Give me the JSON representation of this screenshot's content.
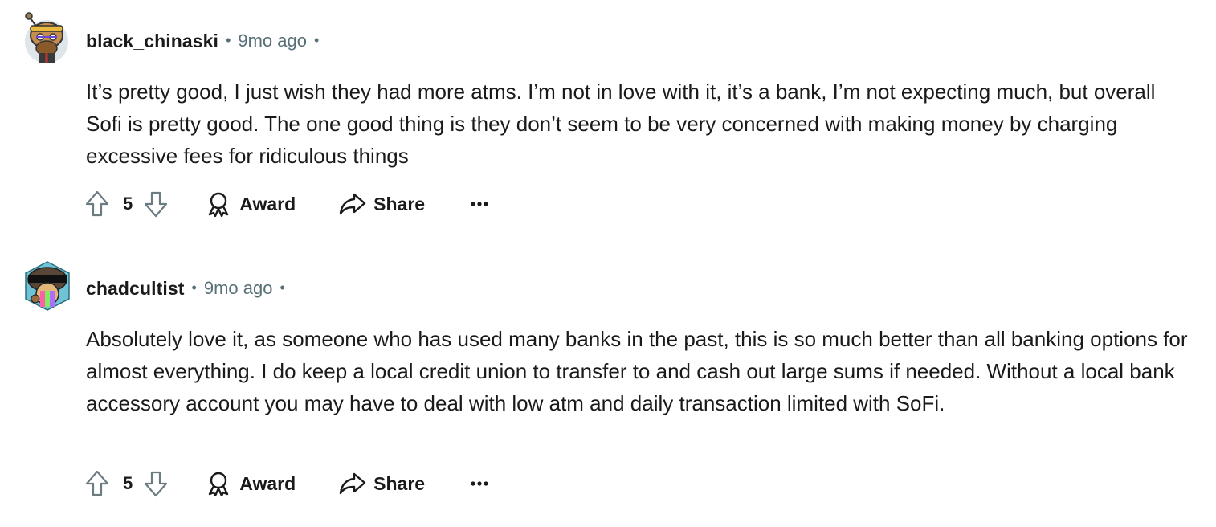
{
  "comments": [
    {
      "username": "black_chinaski",
      "separator": "•",
      "time": "9mo ago",
      "trailing_separator": "•",
      "body": "It’s pretty good, I just wish they had more atms. I’m not in love with it, it’s a bank, I’m not expecting much, but overall Sofi is pretty good. The one good thing is they don’t seem to be very concerned with making money by charging excessive fees for ridiculous things",
      "votes": "5",
      "award_label": "Award",
      "share_label": "Share",
      "avatar_icon": "snoo-avatar-icon"
    },
    {
      "username": "chadcultist",
      "separator": "•",
      "time": "9mo ago",
      "trailing_separator": "•",
      "body": "Absolutely love it, as someone who has used many banks in the past, this is so much better than all banking options for almost everything. I do keep a local credit union to transfer to and cash out large sums if needed. Without a local bank accessory account you may have to deal with low atm and daily transaction limited with SoFi.",
      "votes": "5",
      "award_label": "Award",
      "share_label": "Share",
      "avatar_icon": "nft-avatar-icon"
    }
  ],
  "icons": {
    "upvote": "upvote-arrow-icon",
    "downvote": "downvote-arrow-icon",
    "award": "award-ribbon-icon",
    "share": "share-arrow-icon",
    "more": "more-options-icon"
  },
  "colors": {
    "text": "#1a1a1b",
    "meta": "#576f76",
    "icon": "#1a1a1b",
    "vote_icon": "#6b7b82"
  }
}
